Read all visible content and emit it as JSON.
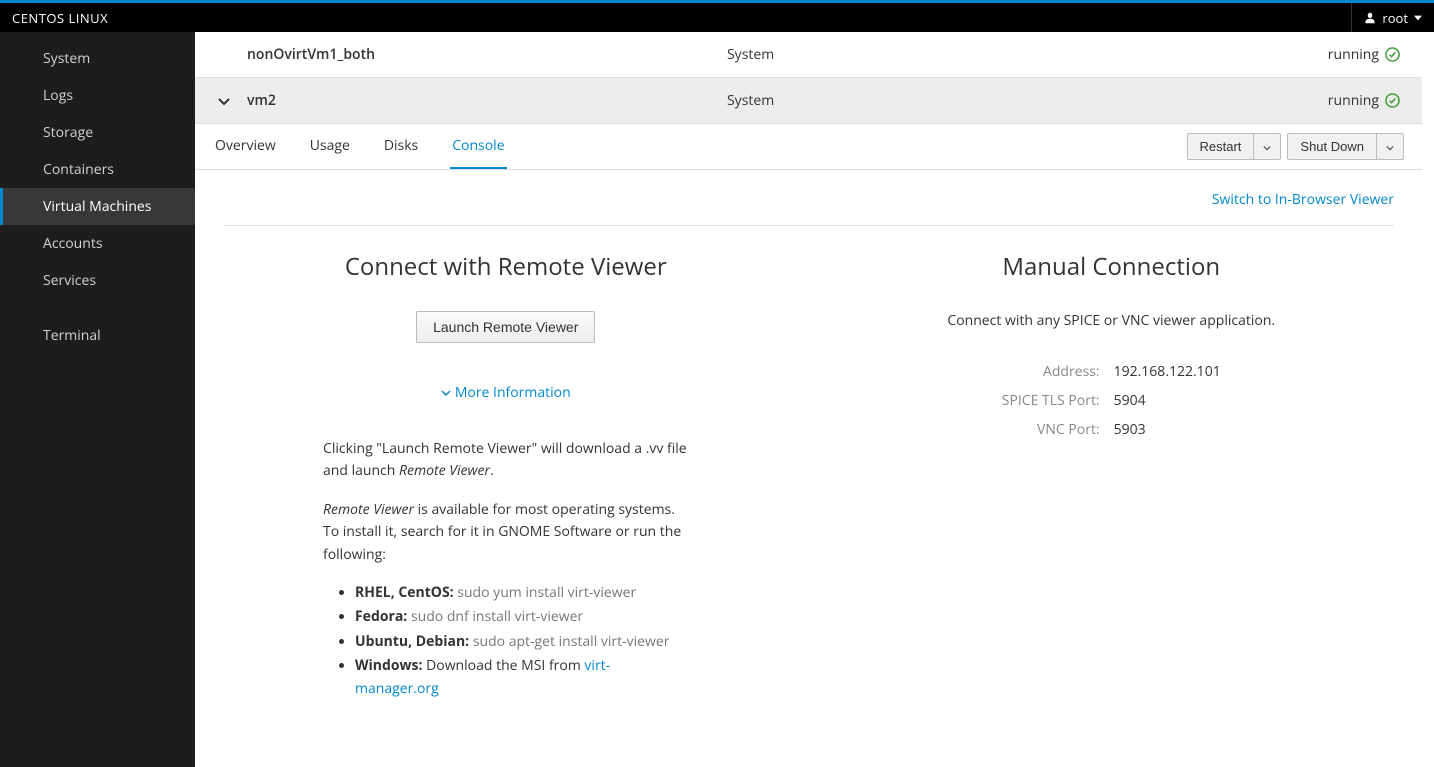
{
  "header": {
    "title": "CENTOS LINUX",
    "user": "root"
  },
  "sidebar": {
    "items": [
      {
        "label": "System"
      },
      {
        "label": "Logs"
      },
      {
        "label": "Storage"
      },
      {
        "label": "Containers"
      },
      {
        "label": "Virtual Machines",
        "active": true
      },
      {
        "label": "Accounts"
      },
      {
        "label": "Services"
      }
    ],
    "terminal": "Terminal"
  },
  "vms": [
    {
      "name": "nonOvirtVm1_both",
      "connection": "System",
      "status": "running"
    },
    {
      "name": "vm2",
      "connection": "System",
      "status": "running"
    }
  ],
  "tabs": {
    "overview": "Overview",
    "usage": "Usage",
    "disks": "Disks",
    "console": "Console"
  },
  "actions": {
    "restart": "Restart",
    "shutdown": "Shut Down"
  },
  "console": {
    "switch_link": "Switch to In-Browser Viewer",
    "remote": {
      "title": "Connect with Remote Viewer",
      "launch": "Launch Remote Viewer",
      "more_info": "More Information",
      "desc1a": "Clicking \"Launch Remote Viewer\" will download a .vv file and launch ",
      "desc1b": "Remote Viewer",
      "desc2a": "Remote Viewer",
      "desc2b": " is available for most operating systems. To install it, search for it in GNOME Software or run the following:",
      "install": {
        "rhel_label": "RHEL, CentOS:",
        "rhel_cmd": "sudo yum install virt-viewer",
        "fedora_label": "Fedora:",
        "fedora_cmd": "sudo dnf install virt-viewer",
        "ubuntu_label": "Ubuntu, Debian:",
        "ubuntu_cmd": "sudo apt-get install virt-viewer",
        "windows_label": "Windows:",
        "windows_text": " Download the MSI from ",
        "windows_link": "virt-manager.org"
      }
    },
    "manual": {
      "title": "Manual Connection",
      "desc": "Connect with any SPICE or VNC viewer application.",
      "address_label": "Address:",
      "address": "192.168.122.101",
      "spice_label": "SPICE TLS Port:",
      "spice": "5904",
      "vnc_label": "VNC Port:",
      "vnc": "5903"
    }
  }
}
